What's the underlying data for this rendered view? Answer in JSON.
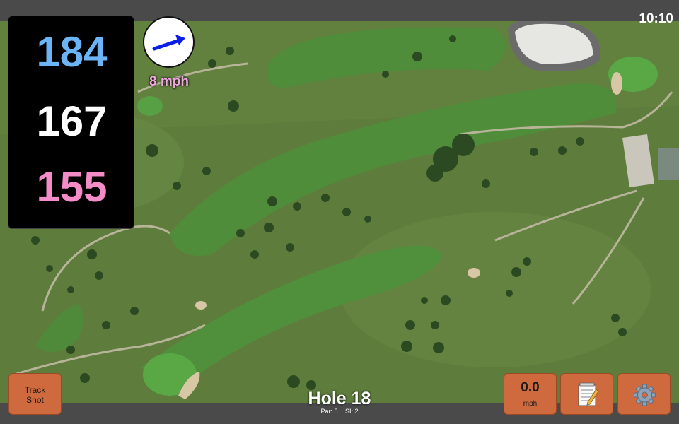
{
  "status": {
    "time": "10:10"
  },
  "distances": {
    "back": "184",
    "middle": "167",
    "front": "155",
    "back_color": "#6cb4f5",
    "middle_color": "#ffffff",
    "front_color": "#f48cc8"
  },
  "wind": {
    "speed_label": "8 mph",
    "label_color": "#f2a6e0",
    "arrow_color": "#0a1ee6",
    "direction_icon": "arrow-right-icon"
  },
  "buttons": {
    "track_shot_line1": "Track",
    "track_shot_line2": "Shot",
    "speed_value": "0.0",
    "speed_unit": "mph",
    "notes_icon": "notepad-icon",
    "settings_icon": "gear-icon",
    "button_color": "#cf6a3e"
  },
  "hole": {
    "title": "Hole 18",
    "par_label": "Par: 5",
    "si_label": "SI: 2"
  }
}
